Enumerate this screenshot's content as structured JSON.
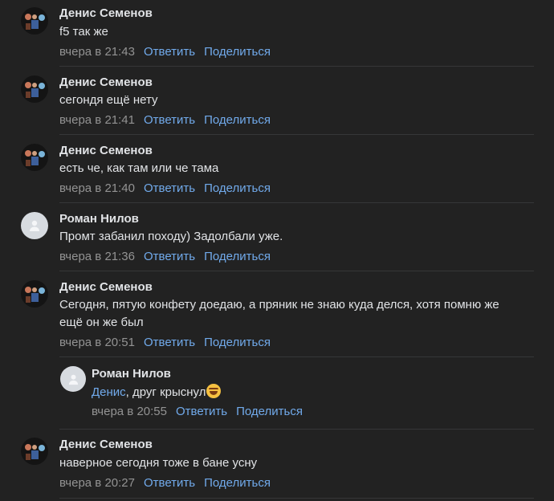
{
  "comments": [
    {
      "author": "Денис Семенов",
      "text": "f5 так же",
      "time": "вчера в 21:43",
      "reply": "Ответить",
      "share": "Поделиться",
      "avatar": "person-photo"
    },
    {
      "author": "Денис Семенов",
      "text": "сегондя ещё нету",
      "time": "вчера в 21:41",
      "reply": "Ответить",
      "share": "Поделиться",
      "avatar": "person-photo"
    },
    {
      "author": "Денис Семенов",
      "text": "есть че, как там или че тама",
      "time": "вчера в 21:40",
      "reply": "Ответить",
      "share": "Поделиться",
      "avatar": "person-photo"
    },
    {
      "author": "Роман Нилов",
      "text": "Промт забанил походу) Задолбали уже.",
      "time": "вчера в 21:36",
      "reply": "Ответить",
      "share": "Поделиться",
      "avatar": "default-user"
    },
    {
      "author": "Денис Семенов",
      "text": "Сегодня, пятую конфету доедаю, а пряник не знаю куда делся, хотя помню же ещё он же был",
      "time": "вчера в 20:51",
      "reply": "Ответить",
      "share": "Поделиться",
      "avatar": "person-photo"
    },
    {
      "author": "Денис Семенов",
      "text": "наверное сегодня тоже в бане усну",
      "time": "вчера в 20:27",
      "reply": "Ответить",
      "share": "Поделиться",
      "avatar": "person-photo"
    }
  ],
  "reply": {
    "author": "Роман Нилов",
    "mention": "Денис",
    "text": ", друг крыснул",
    "emoji": "rolling-on-floor-laughing-emoji",
    "time": "вчера в 20:55",
    "reply": "Ответить",
    "share": "Поделиться",
    "avatar": "default-user"
  },
  "colors": {
    "background": "#222222",
    "link": "#71aaeb",
    "time": "#939393",
    "text": "#e1e3e6",
    "divider": "#363738"
  }
}
